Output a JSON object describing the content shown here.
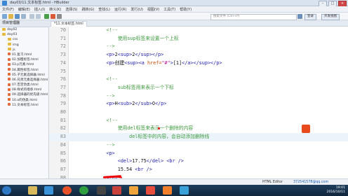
{
  "window": {
    "title": "day03/11.文本标签.html - HBuilder"
  },
  "menu": [
    "文件(F)",
    "编辑(E)",
    "插入(I)",
    "转义(K)",
    "选择(S)",
    "跳转(G)",
    "查找(L)",
    "运行(R)",
    "发行(U)",
    "视图(V)",
    "工具(T)",
    "帮助(Y)"
  ],
  "toolbar": {
    "search_placeholder": "搜索文件 (Ctrl+P)",
    "switch_label": "开发视图",
    "login_label": "登录"
  },
  "left_panel": {
    "header": "项目管理器",
    "tree": [
      {
        "label": "day02",
        "type": "folder",
        "indent": 0
      },
      {
        "label": "day03",
        "type": "folder",
        "indent": 0
      },
      {
        "label": "css",
        "type": "folder",
        "indent": 1
      },
      {
        "label": "img",
        "type": "folder",
        "indent": 1
      },
      {
        "label": "js",
        "type": "folder",
        "indent": 1
      },
      {
        "label": "01.复习.html",
        "type": "file",
        "indent": 1
      },
      {
        "label": "02.加粗标签.html",
        "type": "file",
        "indent": 1
      },
      {
        "label": "03.p元素.html",
        "type": "file",
        "indent": 1
      },
      {
        "label": "04.属性标签.html",
        "type": "file",
        "indent": 1
      },
      {
        "label": "05.子元素选择器.html",
        "type": "file",
        "indent": 1
      },
      {
        "label": "06.兄弟元素选择器.html",
        "type": "file",
        "indent": 1
      },
      {
        "label": "07.否定伪类.html",
        "type": "file",
        "indent": 1
      },
      {
        "label": "08.样式的继承.html",
        "type": "file",
        "indent": 1
      },
      {
        "label": "09.选择器的优先级.html",
        "type": "file",
        "indent": 1
      },
      {
        "label": "10.a的伪类.html",
        "type": "file",
        "indent": 1
      },
      {
        "label": "11.文本标签.html",
        "type": "file",
        "indent": 1
      }
    ]
  },
  "editor": {
    "tab_label": "*11.文本标签.html",
    "highlighted_line": 83,
    "lines": [
      {
        "n": "70",
        "parts": [
          {
            "c": "c-comment",
            "t": "    <!--"
          }
        ]
      },
      {
        "n": "71",
        "parts": [
          {
            "c": "c-comment",
            "t": "        使用sup标签来设置一个上标"
          }
        ]
      },
      {
        "n": "72",
        "parts": [
          {
            "c": "c-comment",
            "t": "    -->"
          }
        ]
      },
      {
        "n": "73",
        "parts": [
          {
            "c": "c-tag",
            "t": "    <p>"
          },
          {
            "c": "c-text",
            "t": "2"
          },
          {
            "c": "c-tag",
            "t": "<sup>"
          },
          {
            "c": "c-text",
            "t": "2"
          },
          {
            "c": "c-tag",
            "t": "</sup></p>"
          }
        ]
      },
      {
        "n": "74",
        "parts": [
          {
            "c": "c-tag",
            "t": "    <p>"
          },
          {
            "c": "c-text",
            "t": "创建"
          },
          {
            "c": "c-tag",
            "t": "<sup><a "
          },
          {
            "c": "c-attr",
            "t": "href="
          },
          {
            "c": "c-str",
            "t": "\"#\""
          },
          {
            "c": "c-tag",
            "t": ">"
          },
          {
            "c": "c-text",
            "t": "[1]"
          },
          {
            "c": "c-tag",
            "t": "</a></sup></p>"
          }
        ]
      },
      {
        "n": "75",
        "parts": [
          {
            "c": "c-text",
            "t": ""
          }
        ]
      },
      {
        "n": "76",
        "parts": [
          {
            "c": "c-comment",
            "t": "    <!--"
          }
        ]
      },
      {
        "n": "77",
        "parts": [
          {
            "c": "c-comment",
            "t": "        sub标签用来表示一个下标"
          }
        ]
      },
      {
        "n": "78",
        "parts": [
          {
            "c": "c-comment",
            "t": "    -->"
          }
        ]
      },
      {
        "n": "79",
        "parts": [
          {
            "c": "c-tag",
            "t": "    <p>"
          },
          {
            "c": "c-text",
            "t": "H"
          },
          {
            "c": "c-tag",
            "t": "<sub>"
          },
          {
            "c": "c-text",
            "t": "2"
          },
          {
            "c": "c-tag",
            "t": "</sub>"
          },
          {
            "c": "c-text",
            "t": "O"
          },
          {
            "c": "c-tag",
            "t": "</p>"
          }
        ]
      },
      {
        "n": "80",
        "parts": [
          {
            "c": "c-text",
            "t": ""
          }
        ]
      },
      {
        "n": "81",
        "parts": [
          {
            "c": "c-comment",
            "t": "    <!--"
          }
        ]
      },
      {
        "n": "82",
        "parts": [
          {
            "c": "c-comment",
            "t": "        使用del标签来表示一个删除的内容"
          }
        ]
      },
      {
        "n": "83",
        "parts": [
          {
            "c": "c-comment",
            "t": "            del标签中的内容，会自动添加删除线"
          }
        ]
      },
      {
        "n": "84",
        "parts": [
          {
            "c": "c-comment",
            "t": "    -->"
          }
        ]
      },
      {
        "n": "85",
        "parts": [
          {
            "c": "c-tag",
            "t": "    <p>"
          }
        ]
      },
      {
        "n": "86",
        "parts": [
          {
            "c": "c-tag",
            "t": "        <del>"
          },
          {
            "c": "c-text",
            "t": "17.75"
          },
          {
            "c": "c-tag",
            "t": "</del>"
          },
          {
            "c": "c-text",
            "t": " "
          },
          {
            "c": "c-tag",
            "t": "<br />"
          }
        ]
      },
      {
        "n": "87",
        "parts": [
          {
            "c": "c-text",
            "t": "        15.54 "
          },
          {
            "c": "c-tag",
            "t": "<br />"
          }
        ]
      },
      {
        "n": "88",
        "parts": [
          {
            "c": "c-tag",
            "t": "    </p>"
          }
        ]
      }
    ]
  },
  "status": {
    "mode": "HTML Editor",
    "user": "372541578@qq.com"
  },
  "clock": {
    "time": "19:01",
    "date": "2016/10/11"
  }
}
